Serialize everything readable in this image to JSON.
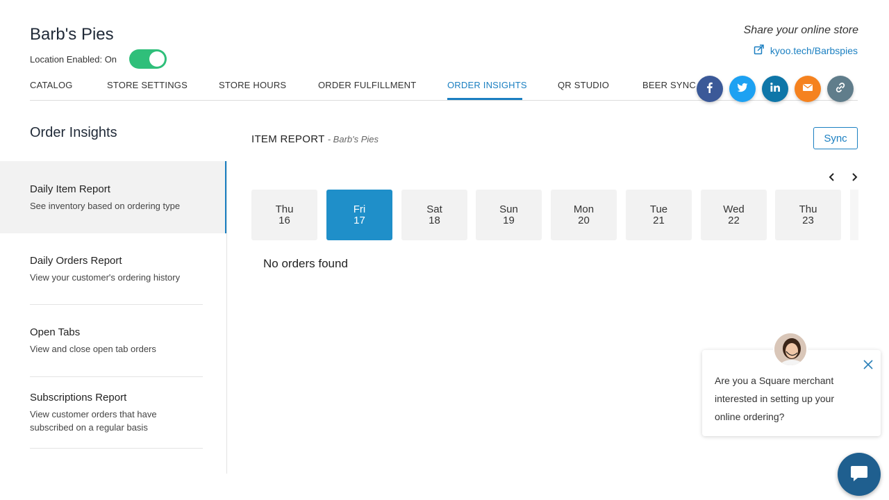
{
  "store": {
    "name": "Barb's Pies",
    "location_label": "Location Enabled: On",
    "location_enabled": true
  },
  "share": {
    "title": "Share your online store",
    "link": "kyoo.tech/Barbspies"
  },
  "tabs": [
    {
      "label": "CATALOG",
      "active": false
    },
    {
      "label": "STORE SETTINGS",
      "active": false
    },
    {
      "label": "STORE HOURS",
      "active": false
    },
    {
      "label": "ORDER FULFILLMENT",
      "active": false
    },
    {
      "label": "ORDER INSIGHTS",
      "active": true
    },
    {
      "label": "QR STUDIO",
      "active": false
    },
    {
      "label": "BEER SYNC",
      "active": false
    }
  ],
  "social_icons": [
    {
      "name": "facebook-icon",
      "color": "#3b5998"
    },
    {
      "name": "twitter-icon",
      "color": "#1da1f2"
    },
    {
      "name": "linkedin-icon",
      "color": "#0e76a8"
    },
    {
      "name": "email-icon",
      "color": "#f5821f"
    },
    {
      "name": "link-icon",
      "color": "#607d8b"
    }
  ],
  "sidebar": {
    "title": "Order Insights",
    "items": [
      {
        "title": "Daily Item Report",
        "desc": "See inventory based on ordering type",
        "active": true
      },
      {
        "title": "Daily Orders Report",
        "desc": "View your customer's ordering history",
        "active": false
      },
      {
        "title": "Open Tabs",
        "desc": "View and close open tab orders",
        "active": false
      },
      {
        "title": "Subscriptions Report",
        "desc": "View customer orders that have subscribed on a regular basis",
        "active": false
      }
    ]
  },
  "report": {
    "title": "ITEM REPORT",
    "subtitle": "- Barb's Pies",
    "sync_label": "Sync",
    "empty_message": "No orders found",
    "days": [
      {
        "dow": "Thu",
        "num": "16",
        "active": false
      },
      {
        "dow": "Fri",
        "num": "17",
        "active": true
      },
      {
        "dow": "Sat",
        "num": "18",
        "active": false
      },
      {
        "dow": "Sun",
        "num": "19",
        "active": false
      },
      {
        "dow": "Mon",
        "num": "20",
        "active": false
      },
      {
        "dow": "Tue",
        "num": "21",
        "active": false
      },
      {
        "dow": "Wed",
        "num": "22",
        "active": false
      },
      {
        "dow": "Thu",
        "num": "23",
        "active": false
      }
    ]
  },
  "chat": {
    "message": "Are you a Square merchant interested in setting up your online ordering?"
  },
  "colors": {
    "accent": "#1a7fc1",
    "toggle_on": "#2fbf7a",
    "selected_day": "#1f8fc9"
  }
}
